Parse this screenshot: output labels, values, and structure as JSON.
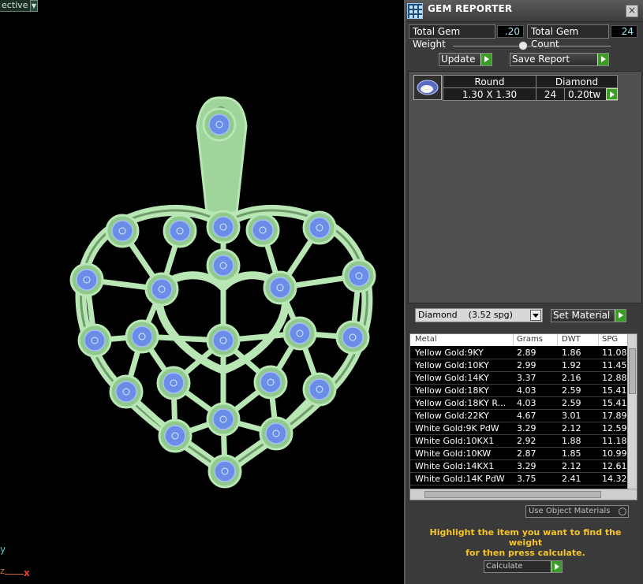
{
  "viewport": {
    "view_label": "ective",
    "axis_y": "y",
    "axis_z": "z",
    "axis_x": "x",
    "model_colors": {
      "metal": "#b8e6b4",
      "gem": "#6a8ee8",
      "background": "#000000"
    }
  },
  "panel": {
    "title": "GEM REPORTER",
    "close_glyph": "×",
    "total_weight_label": "Total Gem Weight",
    "total_weight_value": ".20",
    "total_count_label": "Total Gem Count",
    "total_count_value": "24",
    "update_label": "Update",
    "save_report_label": "Save Report",
    "gem_row": {
      "shape": "Round",
      "type": "Diamond",
      "size": "1.30 X 1.30",
      "count": "24",
      "weight": "0.20tw"
    },
    "material_select": "Diamond    (3.52 spg)",
    "set_material_label": "Set Material",
    "metal_headers": [
      "Metal",
      "Grams",
      "DWT",
      "SPG"
    ],
    "metals": [
      {
        "name": "Yellow Gold:9KY",
        "grams": "2.89",
        "dwt": "1.86",
        "spg": "11.08"
      },
      {
        "name": "Yellow Gold:10KY",
        "grams": "2.99",
        "dwt": "1.92",
        "spg": "11.45"
      },
      {
        "name": "Yellow Gold:14KY",
        "grams": "3.37",
        "dwt": "2.16",
        "spg": "12.88"
      },
      {
        "name": "Yellow Gold:18KY",
        "grams": "4.03",
        "dwt": "2.59",
        "spg": "15.41"
      },
      {
        "name": "Yellow Gold:18KY R...",
        "grams": "4.03",
        "dwt": "2.59",
        "spg": "15.41"
      },
      {
        "name": "Yellow Gold:22KY",
        "grams": "4.67",
        "dwt": "3.01",
        "spg": "17.89"
      },
      {
        "name": "White Gold:9K PdW",
        "grams": "3.29",
        "dwt": "2.12",
        "spg": "12.59"
      },
      {
        "name": "White Gold:10KX1",
        "grams": "2.92",
        "dwt": "1.88",
        "spg": "11.18"
      },
      {
        "name": "White Gold:10KW",
        "grams": "2.87",
        "dwt": "1.85",
        "spg": "10.99"
      },
      {
        "name": "White Gold:14KX1",
        "grams": "3.29",
        "dwt": "2.12",
        "spg": "12.61"
      },
      {
        "name": "White Gold:14K PdW",
        "grams": "3.75",
        "dwt": "2.41",
        "spg": "14.32"
      }
    ],
    "use_object_materials_label": "Use Object Materials",
    "hint_line1": "Highlight the item you want to find the weight",
    "hint_line2": "for then press calculate.",
    "calculate_label": "Calculate"
  }
}
